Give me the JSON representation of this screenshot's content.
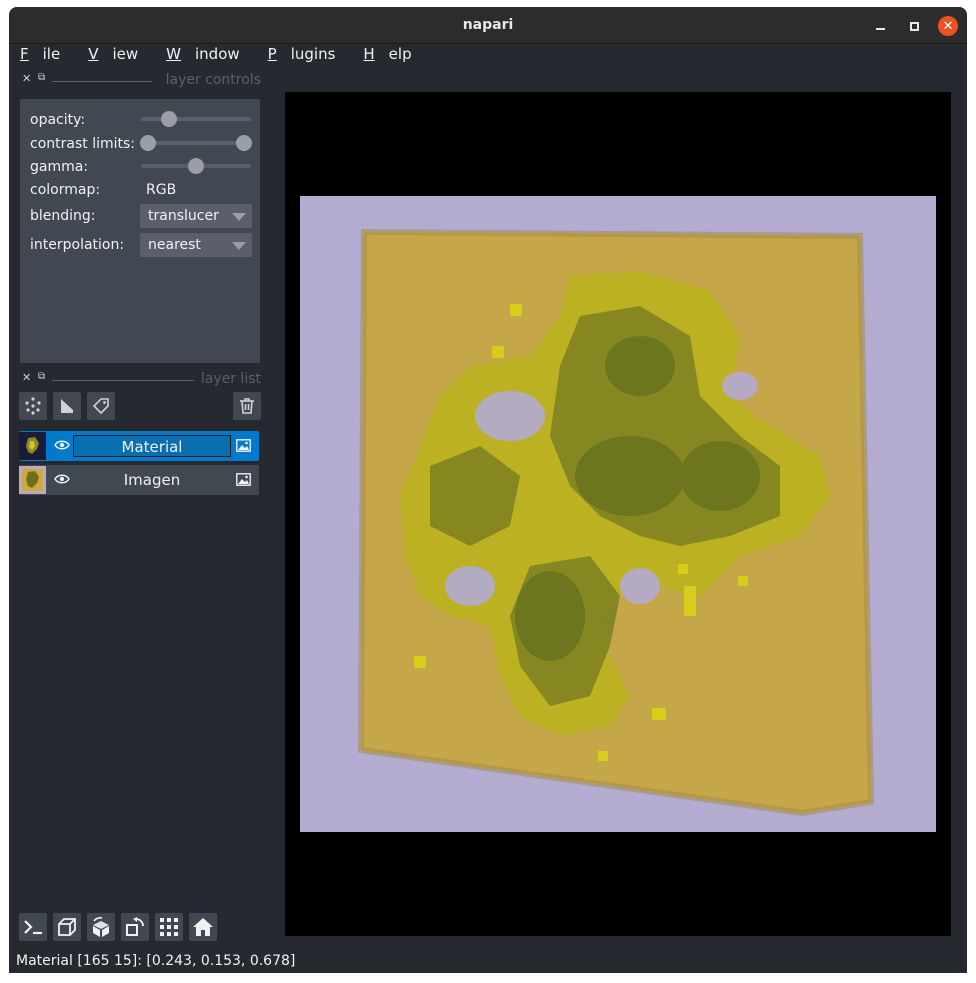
{
  "window": {
    "title": "napari"
  },
  "menu": [
    {
      "underline": "F",
      "rest": "ile"
    },
    {
      "underline": "V",
      "rest": "iew"
    },
    {
      "underline": "W",
      "rest": "indow"
    },
    {
      "underline": "P",
      "rest": "lugins"
    },
    {
      "underline": "H",
      "rest": "elp"
    }
  ],
  "controls_dock": {
    "title": "layer controls"
  },
  "controls": {
    "opacity_label": "opacity:",
    "opacity_value": 0.25,
    "contrast_label": "contrast limits:",
    "contrast_range": [
      0.0,
      1.0
    ],
    "gamma_label": "gamma:",
    "gamma_value": 0.5,
    "colormap_label": "colormap:",
    "colormap_value": "RGB",
    "blending_label": "blending:",
    "blending_value": "translucer",
    "interpolation_label": "interpolation:",
    "interpolation_value": "nearest"
  },
  "layerlist_dock": {
    "title": "layer list"
  },
  "layers": [
    {
      "name": "Material",
      "selected": true,
      "visible": true
    },
    {
      "name": "Imagen",
      "selected": false,
      "visible": true
    }
  ],
  "status": {
    "text": "Material [165  15]: [0.243, 0.153, 0.678]"
  },
  "colors": {
    "accent": "#007acc",
    "background": "#262930",
    "panel": "#414851",
    "close": "#e95420"
  }
}
